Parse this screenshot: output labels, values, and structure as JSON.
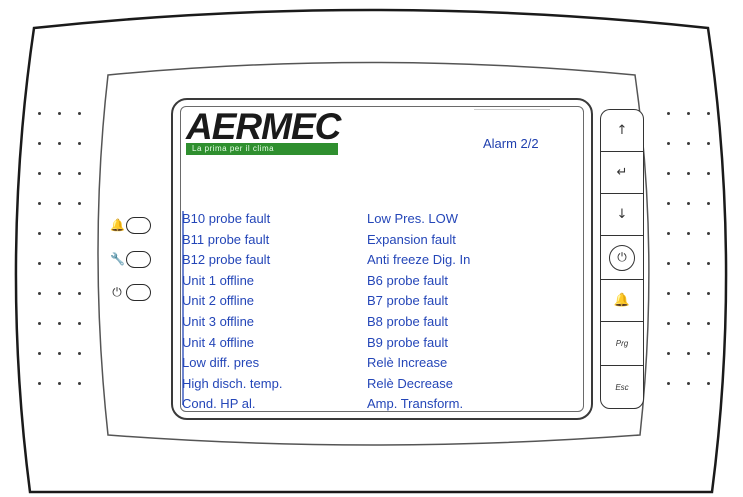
{
  "brand": {
    "name": "AERMEC",
    "tagline": "La prima     per il clima",
    "accent_color": "#2f8f2f"
  },
  "screen": {
    "title": "Alarm 2/2",
    "text_color": "#2446b8",
    "alarms_left": [
      "B10 probe fault",
      "B11 probe fault",
      "B12 probe fault",
      "Unit 1 offline",
      "Unit 2 offline",
      "Unit 3 offline",
      "Unit 4 offline",
      "Low diff. pres",
      "High disch. temp.",
      "Cond. HP al."
    ],
    "alarms_right": [
      "Low Pres. LOW",
      "Expansion  fault",
      "Anti freeze Dig. In",
      "B6 probe fault",
      "B7 probe fault",
      "B8 probe fault",
      "B9 probe fault",
      "Relè Increase",
      "Relè Decrease",
      "Amp. Transform."
    ]
  },
  "leds": [
    {
      "icon": "bell-icon",
      "glyph": "🔔"
    },
    {
      "icon": "wrench-icon",
      "glyph": "🔧"
    },
    {
      "icon": "power-icon",
      "glyph": "⏻"
    }
  ],
  "keypad": [
    {
      "name": "up-key",
      "icon": "arrow-up-icon",
      "glyph": "↑"
    },
    {
      "name": "enter-key",
      "icon": "enter-icon",
      "glyph": "↵"
    },
    {
      "name": "down-key",
      "icon": "arrow-down-icon",
      "glyph": "↓"
    },
    {
      "name": "power-key",
      "icon": "power-icon",
      "glyph": "⏻"
    },
    {
      "name": "alarm-key",
      "icon": "bell-icon",
      "glyph": "🔔"
    },
    {
      "name": "prg-key",
      "label": "Prg"
    },
    {
      "name": "esc-key",
      "label": "Esc"
    }
  ]
}
